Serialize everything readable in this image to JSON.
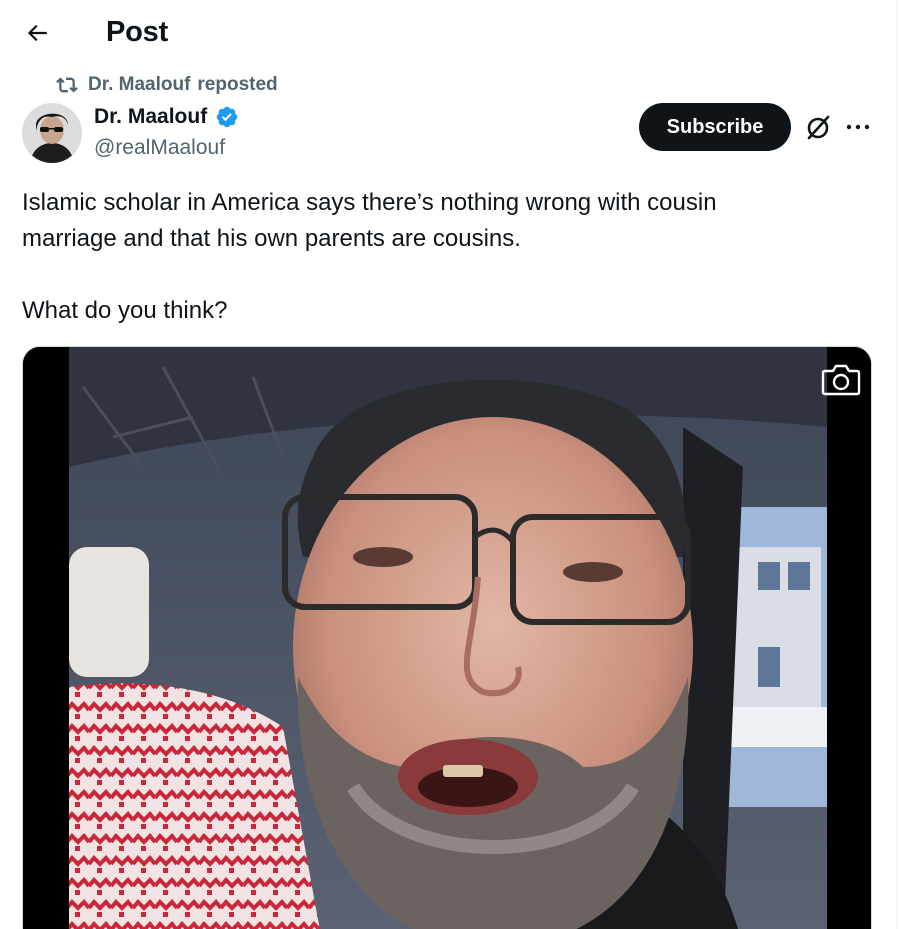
{
  "header": {
    "title": "Post",
    "back_icon": "arrow-left-icon"
  },
  "repost": {
    "icon": "repost-icon",
    "name": "Dr. Maalouf",
    "action": "reposted"
  },
  "author": {
    "display_name": "Dr. Maalouf",
    "handle": "@realMaalouf",
    "verified": true,
    "verified_color": "#1d9bf0"
  },
  "actions": {
    "subscribe_label": "Subscribe",
    "grok_icon": "grok-icon",
    "more_icon": "more-dots-icon"
  },
  "post": {
    "text": "Islamic scholar in America says there’s nothing wrong with cousin\nmarriage and that his own parents are cousins.\n\nWhat do you think?"
  },
  "media": {
    "type": "video",
    "icon": "camera-icon"
  },
  "colors": {
    "text_primary": "#0f1419",
    "text_secondary": "#536471",
    "accent": "#1d9bf0"
  }
}
